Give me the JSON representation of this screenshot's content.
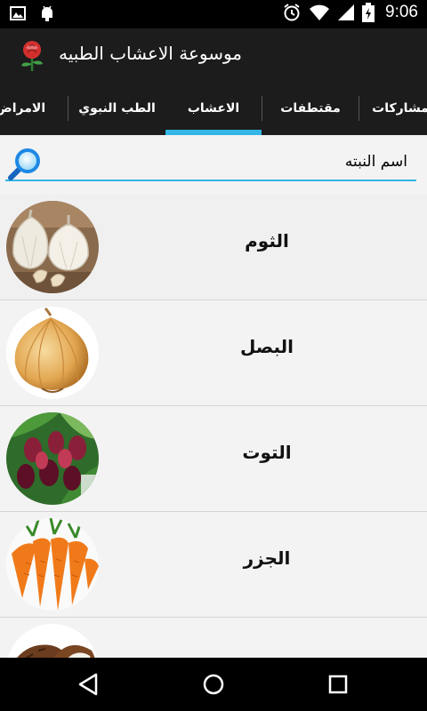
{
  "status": {
    "time": "9:06"
  },
  "app": {
    "title": "موسوعة الاعشاب الطبيه"
  },
  "tabs": [
    {
      "label": "الامراض",
      "active": false
    },
    {
      "label": "الطب النبوي",
      "active": false
    },
    {
      "label": "الاعشاب",
      "active": true
    },
    {
      "label": "مقتطفات",
      "active": false
    },
    {
      "label": "مشاركات",
      "active": false
    }
  ],
  "search": {
    "placeholder": "اسم النبته",
    "value": ""
  },
  "herbs": [
    {
      "name": "الثوم",
      "image": "garlic"
    },
    {
      "name": "البصل",
      "image": "onion"
    },
    {
      "name": "التوت",
      "image": "mulberry"
    },
    {
      "name": "الجزر",
      "image": "carrot"
    },
    {
      "name": "",
      "image": "coconut"
    }
  ],
  "colors": {
    "accent": "#33b5e5",
    "bar": "#1c1c1c",
    "list_bg": "#f3f3f3"
  }
}
